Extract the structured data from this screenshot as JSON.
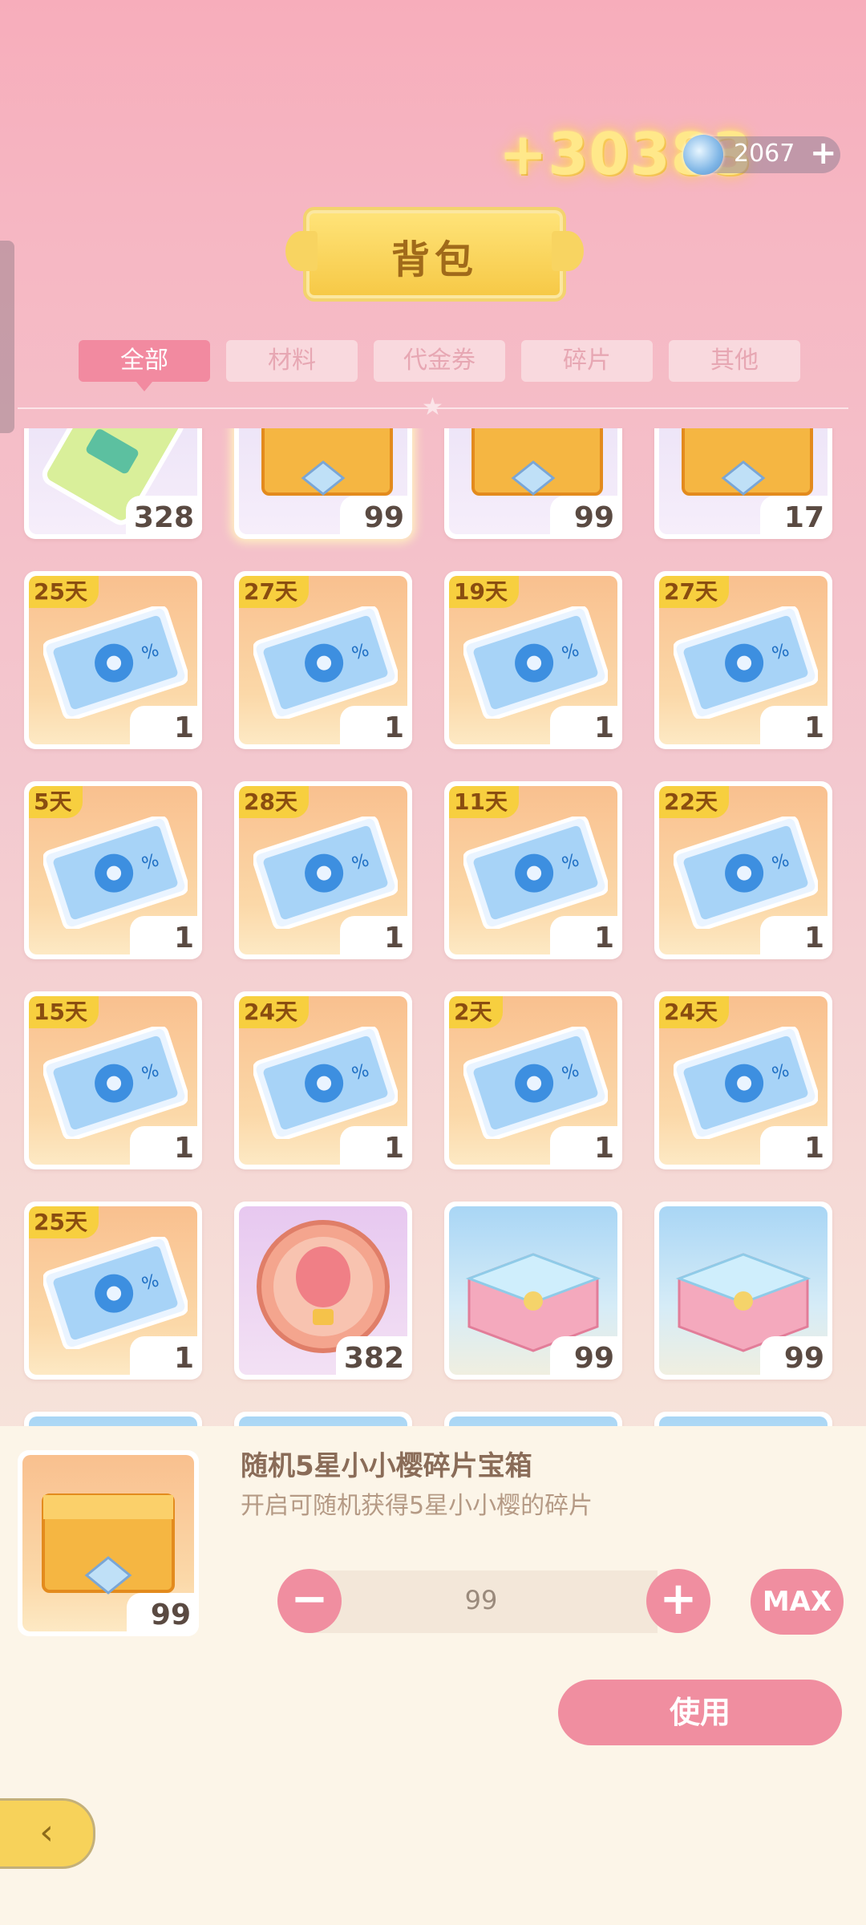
{
  "header": {
    "gain_text": "+30383",
    "currency_value": "2067",
    "currency_plus": "+",
    "title": "背包"
  },
  "tabs": [
    {
      "label": "全部",
      "active": true
    },
    {
      "label": "材料",
      "active": false
    },
    {
      "label": "代金券",
      "active": false
    },
    {
      "label": "碎片",
      "active": false
    },
    {
      "label": "其他",
      "active": false
    }
  ],
  "grid": {
    "row0": [
      {
        "icon": "green-ticket-icon",
        "count": "328"
      },
      {
        "icon": "golden-chest-icon",
        "count": "99"
      },
      {
        "icon": "golden-chest-icon",
        "count": "99"
      },
      {
        "icon": "golden-chest-icon",
        "count": "17"
      }
    ],
    "row1": [
      {
        "icon": "sale-ticket-icon",
        "days": "25天",
        "count": "1"
      },
      {
        "icon": "sale-ticket-icon",
        "days": "27天",
        "count": "1"
      },
      {
        "icon": "sale-ticket-icon",
        "days": "19天",
        "count": "1"
      },
      {
        "icon": "sale-ticket-icon",
        "days": "27天",
        "count": "1"
      }
    ],
    "row2": [
      {
        "icon": "sale-ticket-icon",
        "days": "5天",
        "count": "1"
      },
      {
        "icon": "sale-ticket-icon",
        "days": "28天",
        "count": "1"
      },
      {
        "icon": "sale-ticket-icon",
        "days": "11天",
        "count": "1"
      },
      {
        "icon": "sale-ticket-icon",
        "days": "22天",
        "count": "1"
      }
    ],
    "row3": [
      {
        "icon": "sale-ticket-icon",
        "days": "15天",
        "count": "1"
      },
      {
        "icon": "sale-ticket-icon",
        "days": "24天",
        "count": "1"
      },
      {
        "icon": "sale-ticket-icon",
        "days": "2天",
        "count": "1"
      },
      {
        "icon": "sale-ticket-icon",
        "days": "24天",
        "count": "1"
      }
    ],
    "row4": [
      {
        "icon": "sale-ticket-icon",
        "days": "25天",
        "count": "1"
      },
      {
        "icon": "balloon-coin-icon",
        "count": "382"
      },
      {
        "icon": "blue-gift-box-icon",
        "count": "99"
      },
      {
        "icon": "blue-gift-box-icon",
        "count": "99"
      }
    ]
  },
  "selected": {
    "count": "99",
    "name": "随机5星小小樱碎片宝箱",
    "description": "开启可随机获得5星小小樱的碎片",
    "quantity": "99",
    "minus": "−",
    "plus": "+",
    "max_label": "MAX",
    "use_label": "使用"
  },
  "colors": {
    "accent_pink": "#f08ea0",
    "tab_active": "#f28aa0",
    "gold": "#f7cf3f",
    "panel_bg": "#fcf5e8"
  }
}
